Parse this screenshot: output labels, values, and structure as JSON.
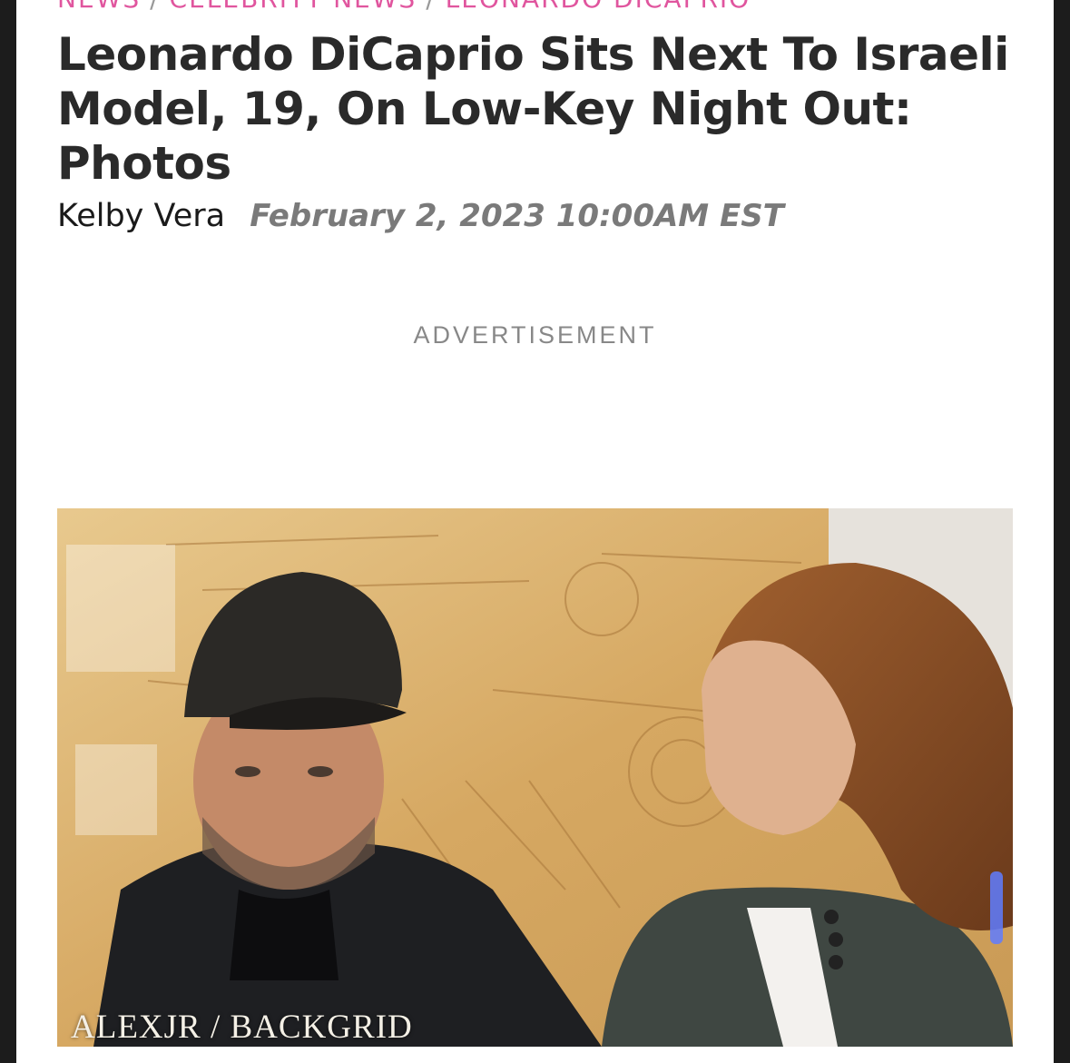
{
  "breadcrumb": [
    "NEWS",
    "CELEBRITY NEWS",
    "LEONARDO DICAPRIO"
  ],
  "headline": "Leonardo DiCaprio Sits Next To Israeli Model, 19, On Low-Key Night Out: Photos",
  "byline": {
    "author": "Kelby Vera",
    "date": "February 2, 2023 10:00AM EST"
  },
  "ad_label": "ADVERTISEMENT",
  "photo": {
    "credit": "ALEXJR / BACKGRID"
  },
  "colors": {
    "breadcrumb_pink": "#e0559e",
    "headline": "#2a2a2a",
    "date_gray": "#7a7a7a",
    "frame_dark": "#1c1c1c"
  }
}
